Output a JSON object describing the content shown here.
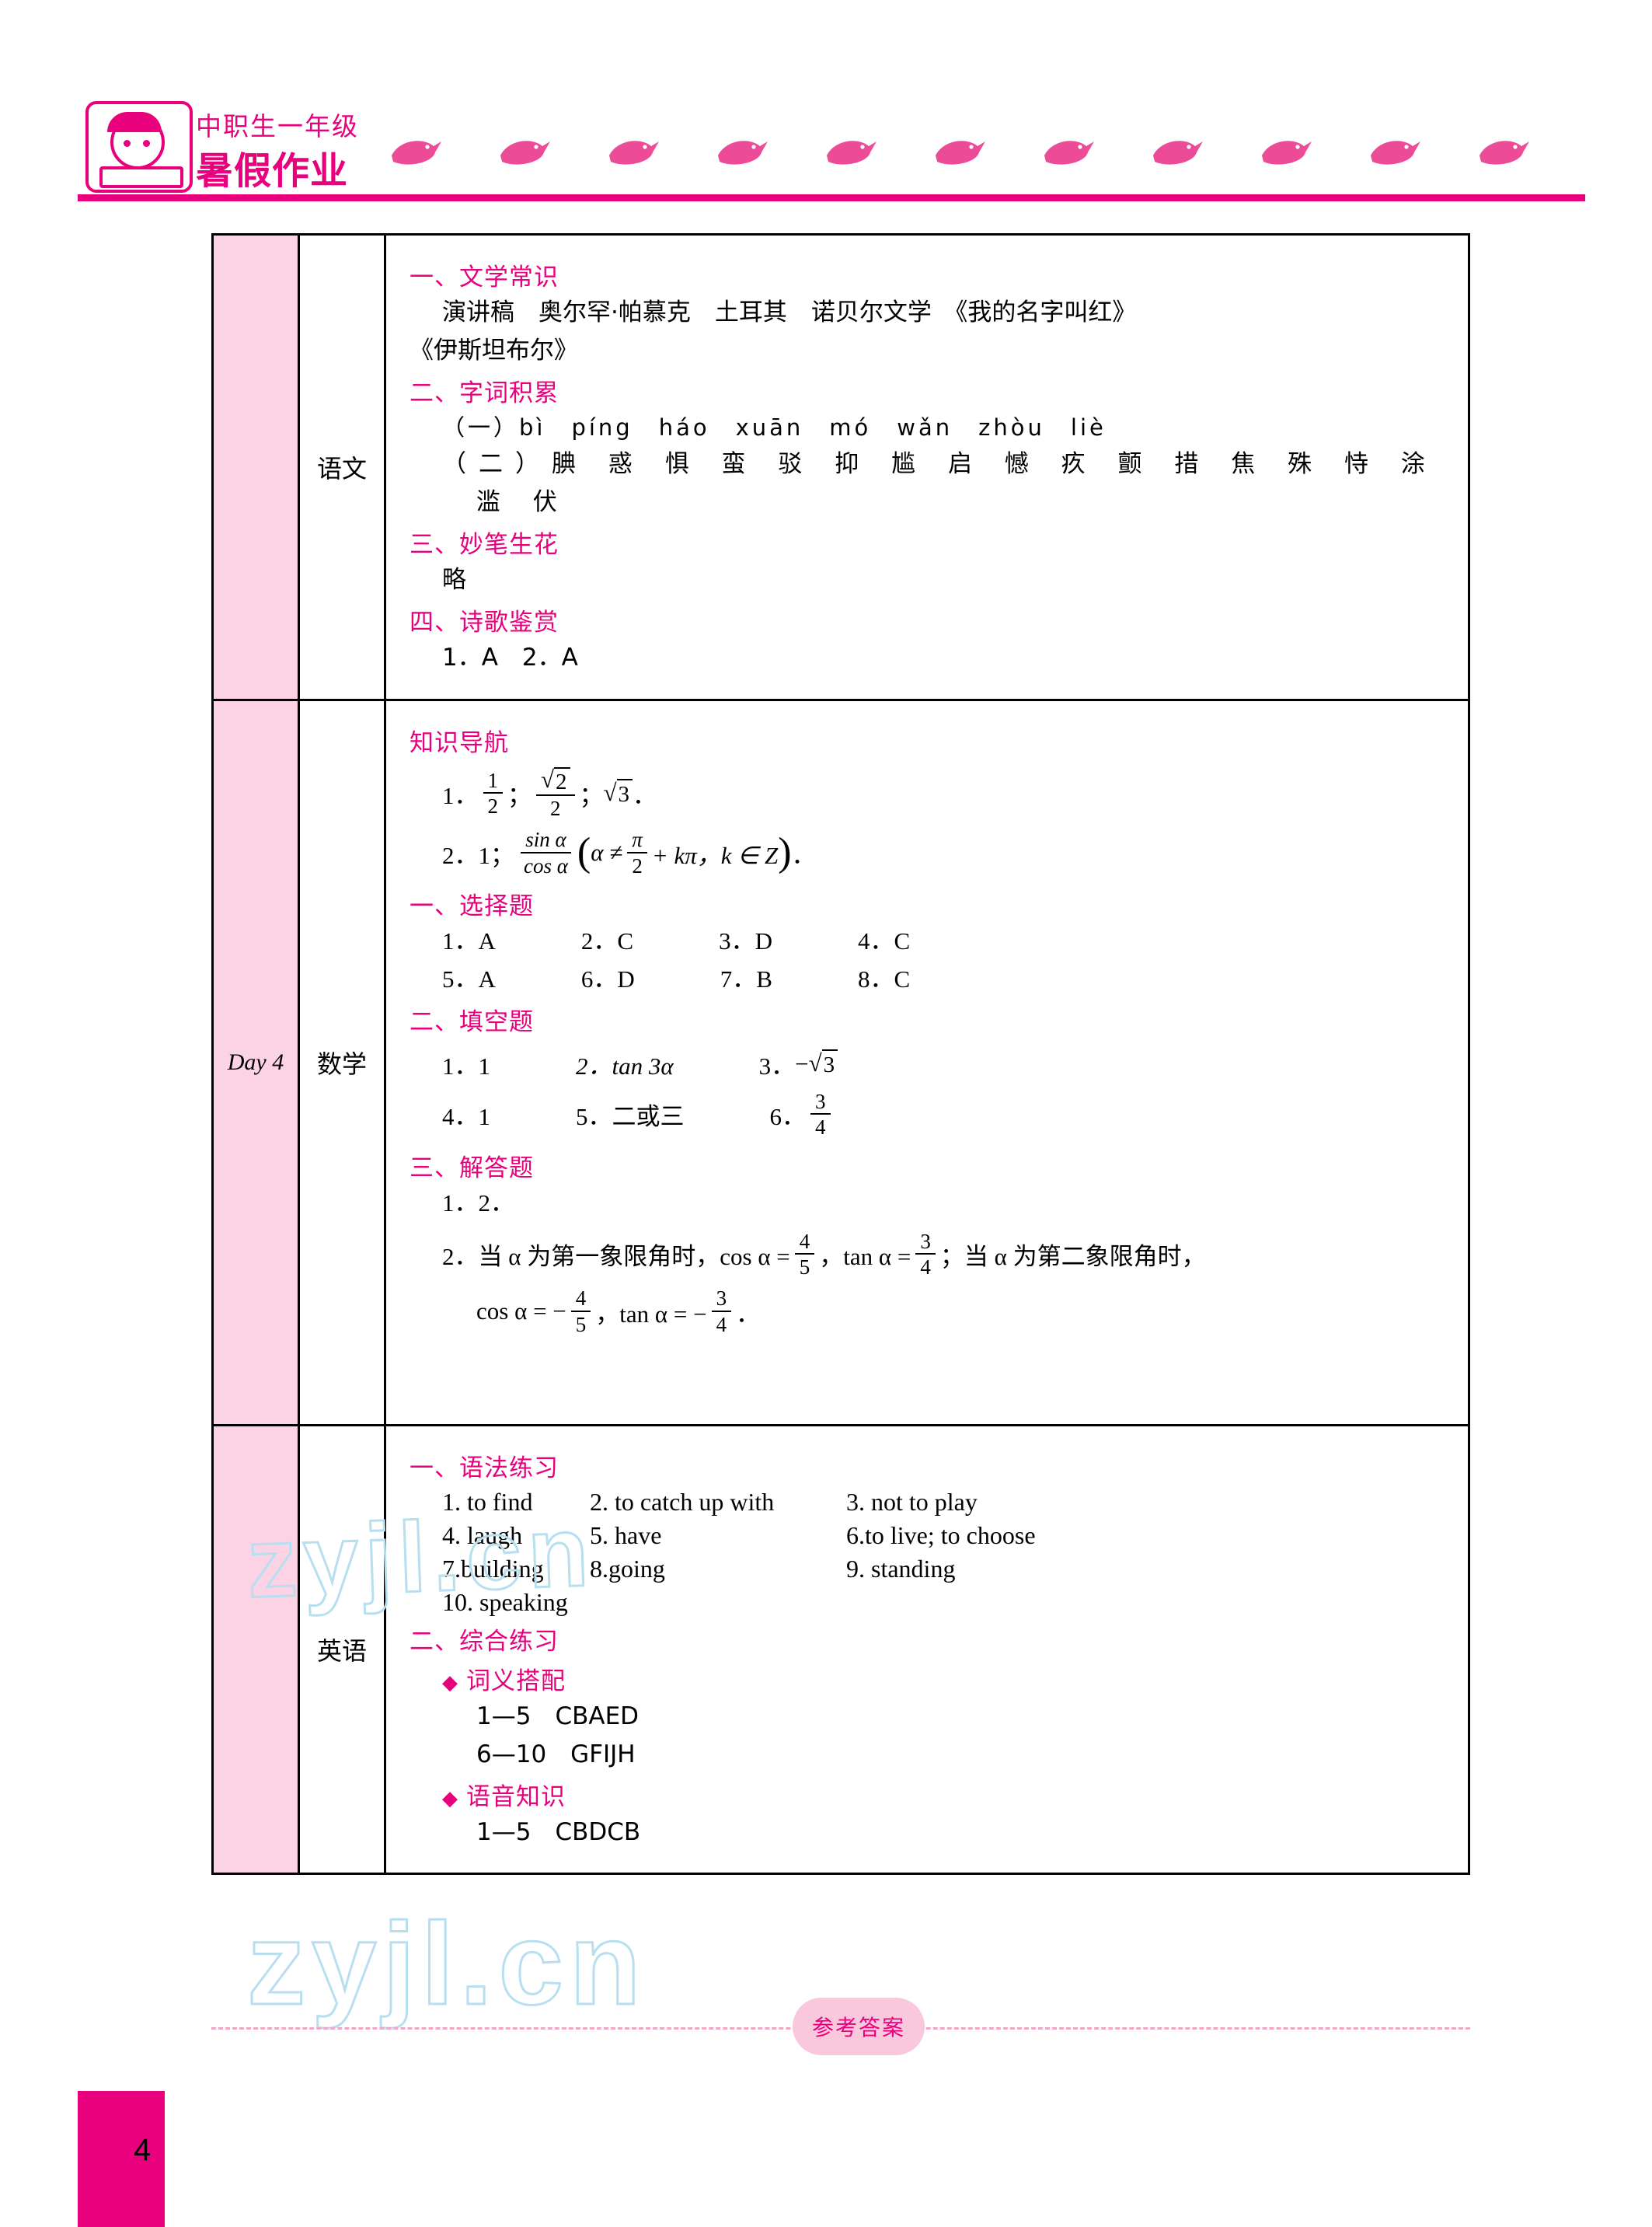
{
  "header": {
    "brand_line1": "中职生一年级",
    "brand_line2": "暑假作业",
    "accent_color": "#e8007d"
  },
  "table": {
    "day_label": "Day 4",
    "rows": [
      {
        "subject": "语文",
        "sections": [
          {
            "heading": "一、文学常识",
            "lines": [
              "演讲稿　奥尔罕·帕慕克　土耳其　诺贝尔文学　《我的名字叫红》",
              "《伊斯坦布尔》"
            ]
          },
          {
            "heading": "二、字词积累",
            "lines": [
              "（一）bì　píng　háo　xuān　mó　wǎn　zhòu　liè",
              "（二）腆 惑 惧 蛮 驳 抑 尴 启 憾 疚 颤 措 焦 殊 恃 涂",
              "滥 伏"
            ]
          },
          {
            "heading": "三、妙笔生花",
            "lines": [
              "略"
            ]
          },
          {
            "heading": "四、诗歌鉴赏",
            "lines": [
              "1．A　2．A"
            ]
          }
        ]
      },
      {
        "subject": "数学",
        "nav_heading": "知识导航",
        "nav_item1_label": "1．",
        "nav_item1_f1_num": "1",
        "nav_item1_f1_den": "2",
        "nav_item1_sep1": "；",
        "nav_item1_f2_num": "2",
        "nav_item1_f2_den": "2",
        "nav_item1_sep2": "；",
        "nav_item1_rad": "3",
        "nav_item1_end": "．",
        "nav_item2_label": "2．1；",
        "nav_item2_num": "sin α",
        "nav_item2_den": "cos α",
        "nav_item2_cond_a": "α ≠",
        "nav_item2_cond_f_num": "π",
        "nav_item2_cond_f_den": "2",
        "nav_item2_cond_b": "+ kπ，k ∈ Z",
        "nav_item2_end": "．",
        "choice_heading": "一、选择题",
        "choice_row1": [
          "1．A",
          "2．C",
          "3．D",
          "4．C"
        ],
        "choice_row2": [
          "5．A",
          "6．D",
          "7．B",
          "8．C"
        ],
        "fill_heading": "二、填空题",
        "fill_1": "1．1",
        "fill_2": "2．tan 3α",
        "fill_3_label": "3．",
        "fill_3_val": "3",
        "fill_4": "4．1",
        "fill_5": "5．二或三",
        "fill_6_label": "6．",
        "fill_6_num": "3",
        "fill_6_den": "4",
        "answer_heading": "三、解答题",
        "answer_1": "1．2．",
        "answer_2_a": "2．当 α 为第一象限角时，cos α =",
        "answer_2_f1_num": "4",
        "answer_2_f1_den": "5",
        "answer_2_b": "，tan α =",
        "answer_2_f2_num": "3",
        "answer_2_f2_den": "4",
        "answer_2_c": "；当 α 为第二象限角时，",
        "answer_3_a": "cos α = −",
        "answer_3_f1_num": "4",
        "answer_3_f1_den": "5",
        "answer_3_b": "，tan α = −",
        "answer_3_f2_num": "3",
        "answer_3_f2_den": "4",
        "answer_3_c": "．"
      },
      {
        "subject": "英语",
        "grammar_heading": "一、语法练习",
        "grammar_rows": [
          [
            "1. to find",
            "2. to catch up with",
            "3. not to play"
          ],
          [
            "4. laugh",
            "5. have",
            "6.to live; to choose"
          ],
          [
            "7.building",
            "8.going",
            "9. standing"
          ],
          [
            "10. speaking",
            "",
            ""
          ]
        ],
        "comprehensive_heading": "二、综合练习",
        "sub1_heading": "词义搭配",
        "sub1_lines": [
          "1—5　CBAED",
          "6—10　GFIJH"
        ],
        "sub2_heading": "语音知识",
        "sub2_lines": [
          "1—5　CBDCB"
        ]
      }
    ]
  },
  "watermarks": {
    "wm1": "zyjl.cn",
    "wm2": "zyjl.cn"
  },
  "footer": {
    "badge": "参考答案",
    "page_number": "4"
  }
}
